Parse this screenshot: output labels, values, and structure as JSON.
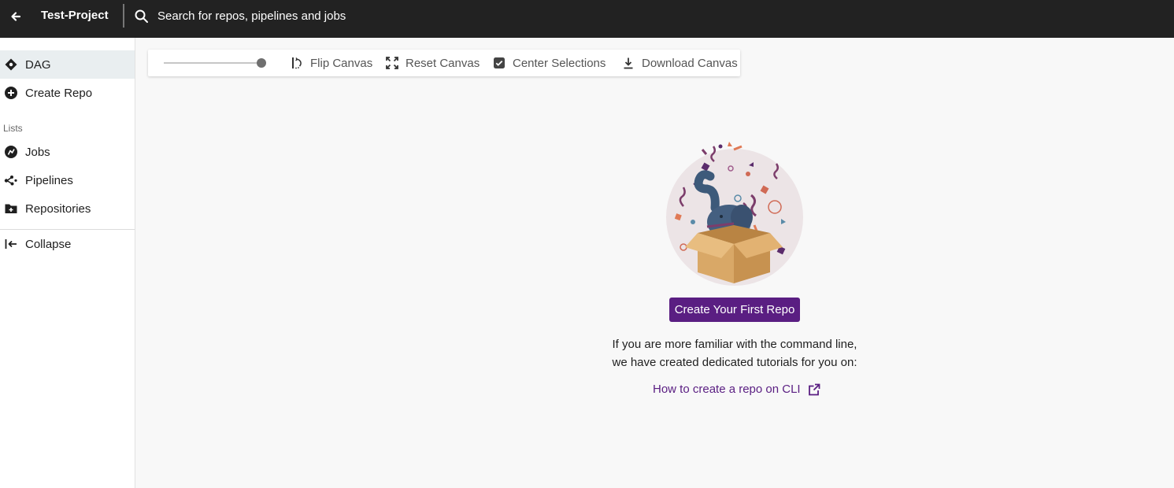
{
  "header": {
    "project_name": "Test-Project",
    "search_placeholder": "Search for repos, pipelines and jobs"
  },
  "sidebar": {
    "items": [
      {
        "label": "DAG",
        "icon": "dag-icon",
        "active": true
      },
      {
        "label": "Create Repo",
        "icon": "plus-circle-icon"
      }
    ],
    "section_label": "Lists",
    "list_items": [
      {
        "label": "Jobs",
        "icon": "jobs-icon"
      },
      {
        "label": "Pipelines",
        "icon": "pipelines-icon"
      },
      {
        "label": "Repositories",
        "icon": "repositories-icon"
      }
    ],
    "collapse_label": "Collapse"
  },
  "toolbar": {
    "slider_value": 1.0,
    "flip_label": "Flip Canvas",
    "reset_label": "Reset Canvas",
    "center_label": "Center Selections",
    "center_checked": true,
    "download_label": "Download Canvas"
  },
  "empty_state": {
    "cta_label": "Create Your First Repo",
    "help_line1": "If you are more familiar with the command line,",
    "help_line2": "we have created dedicated tutorials for you on:",
    "link_label": "How to create a repo on CLI"
  },
  "colors": {
    "topbar": "#222222",
    "accent": "#5a1e82",
    "active_item_bg": "#e9eef0"
  }
}
